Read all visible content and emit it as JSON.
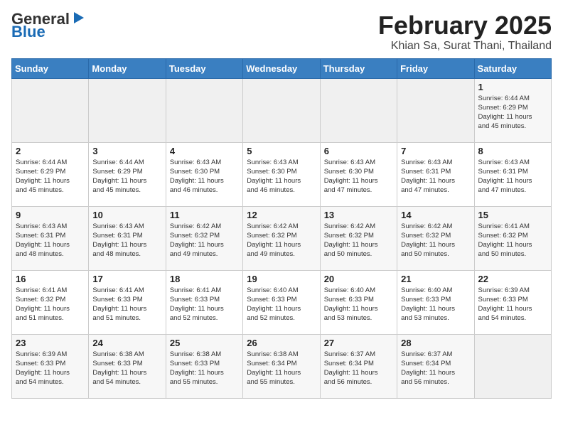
{
  "header": {
    "logo_general": "General",
    "logo_blue": "Blue",
    "month_title": "February 2025",
    "location": "Khian Sa, Surat Thani, Thailand"
  },
  "weekdays": [
    "Sunday",
    "Monday",
    "Tuesday",
    "Wednesday",
    "Thursday",
    "Friday",
    "Saturday"
  ],
  "weeks": [
    [
      {
        "day": "",
        "info": ""
      },
      {
        "day": "",
        "info": ""
      },
      {
        "day": "",
        "info": ""
      },
      {
        "day": "",
        "info": ""
      },
      {
        "day": "",
        "info": ""
      },
      {
        "day": "",
        "info": ""
      },
      {
        "day": "1",
        "info": "Sunrise: 6:44 AM\nSunset: 6:29 PM\nDaylight: 11 hours\nand 45 minutes."
      }
    ],
    [
      {
        "day": "2",
        "info": "Sunrise: 6:44 AM\nSunset: 6:29 PM\nDaylight: 11 hours\nand 45 minutes."
      },
      {
        "day": "3",
        "info": "Sunrise: 6:44 AM\nSunset: 6:29 PM\nDaylight: 11 hours\nand 45 minutes."
      },
      {
        "day": "4",
        "info": "Sunrise: 6:43 AM\nSunset: 6:30 PM\nDaylight: 11 hours\nand 46 minutes."
      },
      {
        "day": "5",
        "info": "Sunrise: 6:43 AM\nSunset: 6:30 PM\nDaylight: 11 hours\nand 46 minutes."
      },
      {
        "day": "6",
        "info": "Sunrise: 6:43 AM\nSunset: 6:30 PM\nDaylight: 11 hours\nand 47 minutes."
      },
      {
        "day": "7",
        "info": "Sunrise: 6:43 AM\nSunset: 6:31 PM\nDaylight: 11 hours\nand 47 minutes."
      },
      {
        "day": "8",
        "info": "Sunrise: 6:43 AM\nSunset: 6:31 PM\nDaylight: 11 hours\nand 47 minutes."
      }
    ],
    [
      {
        "day": "9",
        "info": "Sunrise: 6:43 AM\nSunset: 6:31 PM\nDaylight: 11 hours\nand 48 minutes."
      },
      {
        "day": "10",
        "info": "Sunrise: 6:43 AM\nSunset: 6:31 PM\nDaylight: 11 hours\nand 48 minutes."
      },
      {
        "day": "11",
        "info": "Sunrise: 6:42 AM\nSunset: 6:32 PM\nDaylight: 11 hours\nand 49 minutes."
      },
      {
        "day": "12",
        "info": "Sunrise: 6:42 AM\nSunset: 6:32 PM\nDaylight: 11 hours\nand 49 minutes."
      },
      {
        "day": "13",
        "info": "Sunrise: 6:42 AM\nSunset: 6:32 PM\nDaylight: 11 hours\nand 50 minutes."
      },
      {
        "day": "14",
        "info": "Sunrise: 6:42 AM\nSunset: 6:32 PM\nDaylight: 11 hours\nand 50 minutes."
      },
      {
        "day": "15",
        "info": "Sunrise: 6:41 AM\nSunset: 6:32 PM\nDaylight: 11 hours\nand 50 minutes."
      }
    ],
    [
      {
        "day": "16",
        "info": "Sunrise: 6:41 AM\nSunset: 6:32 PM\nDaylight: 11 hours\nand 51 minutes."
      },
      {
        "day": "17",
        "info": "Sunrise: 6:41 AM\nSunset: 6:33 PM\nDaylight: 11 hours\nand 51 minutes."
      },
      {
        "day": "18",
        "info": "Sunrise: 6:41 AM\nSunset: 6:33 PM\nDaylight: 11 hours\nand 52 minutes."
      },
      {
        "day": "19",
        "info": "Sunrise: 6:40 AM\nSunset: 6:33 PM\nDaylight: 11 hours\nand 52 minutes."
      },
      {
        "day": "20",
        "info": "Sunrise: 6:40 AM\nSunset: 6:33 PM\nDaylight: 11 hours\nand 53 minutes."
      },
      {
        "day": "21",
        "info": "Sunrise: 6:40 AM\nSunset: 6:33 PM\nDaylight: 11 hours\nand 53 minutes."
      },
      {
        "day": "22",
        "info": "Sunrise: 6:39 AM\nSunset: 6:33 PM\nDaylight: 11 hours\nand 54 minutes."
      }
    ],
    [
      {
        "day": "23",
        "info": "Sunrise: 6:39 AM\nSunset: 6:33 PM\nDaylight: 11 hours\nand 54 minutes."
      },
      {
        "day": "24",
        "info": "Sunrise: 6:38 AM\nSunset: 6:33 PM\nDaylight: 11 hours\nand 54 minutes."
      },
      {
        "day": "25",
        "info": "Sunrise: 6:38 AM\nSunset: 6:33 PM\nDaylight: 11 hours\nand 55 minutes."
      },
      {
        "day": "26",
        "info": "Sunrise: 6:38 AM\nSunset: 6:34 PM\nDaylight: 11 hours\nand 55 minutes."
      },
      {
        "day": "27",
        "info": "Sunrise: 6:37 AM\nSunset: 6:34 PM\nDaylight: 11 hours\nand 56 minutes."
      },
      {
        "day": "28",
        "info": "Sunrise: 6:37 AM\nSunset: 6:34 PM\nDaylight: 11 hours\nand 56 minutes."
      },
      {
        "day": "",
        "info": ""
      }
    ]
  ]
}
